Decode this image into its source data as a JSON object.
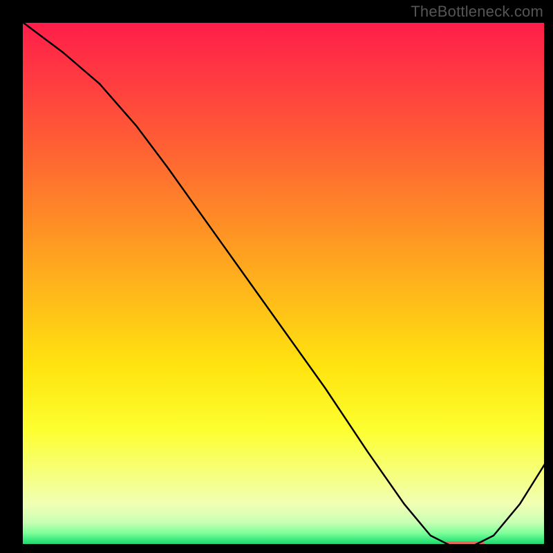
{
  "watermark": "TheBottleneck.com",
  "chart_data": {
    "type": "line",
    "title": "",
    "xlabel": "",
    "ylabel": "",
    "xlim": [
      0,
      100
    ],
    "ylim": [
      0,
      100
    ],
    "grid": false,
    "legend": false,
    "gradient_background": {
      "stops": [
        {
          "offset": 0.0,
          "color": "#ff1d4a"
        },
        {
          "offset": 0.1,
          "color": "#ff3842"
        },
        {
          "offset": 0.22,
          "color": "#ff5a36"
        },
        {
          "offset": 0.38,
          "color": "#ff8c26"
        },
        {
          "offset": 0.52,
          "color": "#ffb91a"
        },
        {
          "offset": 0.66,
          "color": "#ffe40f"
        },
        {
          "offset": 0.78,
          "color": "#fdff30"
        },
        {
          "offset": 0.86,
          "color": "#f6ff7a"
        },
        {
          "offset": 0.92,
          "color": "#f1ffb4"
        },
        {
          "offset": 0.955,
          "color": "#c8ffb4"
        },
        {
          "offset": 0.975,
          "color": "#7fff9a"
        },
        {
          "offset": 0.99,
          "color": "#32e67a"
        },
        {
          "offset": 1.0,
          "color": "#1fc86a"
        }
      ]
    },
    "series": [
      {
        "name": "bottleneck-curve",
        "color": "#000000",
        "x": [
          0.0,
          8.0,
          15.0,
          22.0,
          28.0,
          38.0,
          48.0,
          58.0,
          66.0,
          73.0,
          78.0,
          82.0,
          86.0,
          90.0,
          95.0,
          100.0
        ],
        "y": [
          100.0,
          94.0,
          88.0,
          80.0,
          72.0,
          58.0,
          44.0,
          30.0,
          18.0,
          8.0,
          2.0,
          0.0,
          0.0,
          2.0,
          8.0,
          16.0
        ]
      }
    ],
    "marker": {
      "name": "optimal-range-marker",
      "color": "#e26a5a",
      "x_start": 80.5,
      "x_end": 88.5,
      "y": 0.0,
      "thickness_pct": 1.0
    }
  }
}
